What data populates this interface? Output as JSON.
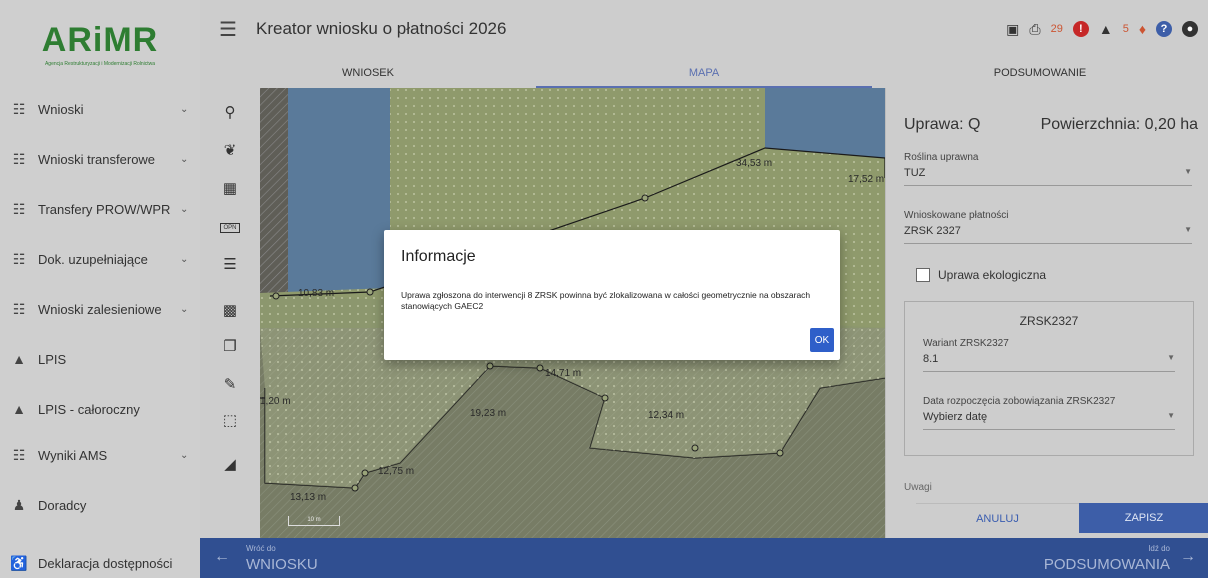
{
  "logo": {
    "text": "ARiMR",
    "subtitle": "Agencja Restrukturyzacji i Modernizacji Rolnictwa"
  },
  "header": {
    "title": "Kreator wniosku o płatności 2026",
    "error_count": "29",
    "warning_count": "5"
  },
  "tabs": [
    {
      "label": "WNIOSEK",
      "active": false
    },
    {
      "label": "MAPA",
      "active": true
    },
    {
      "label": "PODSUMOWANIE",
      "active": false
    }
  ],
  "sidebar": {
    "items": [
      {
        "label": "Wnioski",
        "icon": "clipboard-icon",
        "expandable": true
      },
      {
        "label": "Wnioski transferowe",
        "icon": "clipboard-icon",
        "expandable": true
      },
      {
        "label": "Transfery PROW/WPR",
        "icon": "clipboard-icon",
        "expandable": true
      },
      {
        "label": "Dok. uzupełniające",
        "icon": "clipboard-icon",
        "expandable": true
      },
      {
        "label": "Wnioski zalesieniowe",
        "icon": "clipboard-icon",
        "expandable": true
      },
      {
        "label": "LPIS",
        "icon": "terrain-icon",
        "expandable": false
      },
      {
        "label": "LPIS - całoroczny",
        "icon": "terrain-icon",
        "expandable": false
      },
      {
        "label": "Wyniki AMS",
        "icon": "clipboard-icon",
        "expandable": true
      },
      {
        "label": "Doradcy",
        "icon": "person-icon",
        "expandable": false
      },
      {
        "label": "Deklaracja dostępności",
        "icon": "accessibility-icon",
        "expandable": false
      }
    ]
  },
  "map": {
    "segment_labels": [
      "34,53 m",
      "17,52 m",
      "10,83 m",
      "14,71 m",
      "19,23 m",
      "12,34 m",
      "12,75 m",
      "13,13 m",
      "1,20 m"
    ],
    "scale": "10 m"
  },
  "panel": {
    "crop_label": "Uprawa: Q",
    "area_label": "Powierzchnia: 0,20 ha",
    "crop_field": {
      "label": "Roślina uprawna",
      "value": "TUZ"
    },
    "payments_field": {
      "label": "Wnioskowane płatności",
      "value": "ZRSK 2327"
    },
    "eco_label": "Uprawa ekologiczna",
    "subsection_title": "ZRSK2327",
    "variant_field": {
      "label": "Wariant ZRSK2327",
      "value": "8.1"
    },
    "date_field": {
      "label": "Data rozpoczęcia zobowiązania ZRSK2327",
      "value": "Wybierz datę"
    },
    "notes_label": "Uwagi",
    "cancel_label": "ANULUJ",
    "save_label": "ZAPISZ"
  },
  "bottom_nav": {
    "back_small": "Wróć do",
    "back_big": "WNIOSKU",
    "forward_small": "Idź do",
    "forward_big": "PODSUMOWANIA"
  },
  "modal": {
    "title": "Informacje",
    "message": "Uprawa zgłoszona do interwencji 8 ZRSK powinna być zlokalizowana w całości geometrycznie na obszarach stanowiących GAEC2",
    "ok_label": "OK"
  },
  "colors": {
    "brand": "#2e7d32",
    "accent": "#3d5ea8",
    "error": "#c62828",
    "warning": "#c53"
  }
}
